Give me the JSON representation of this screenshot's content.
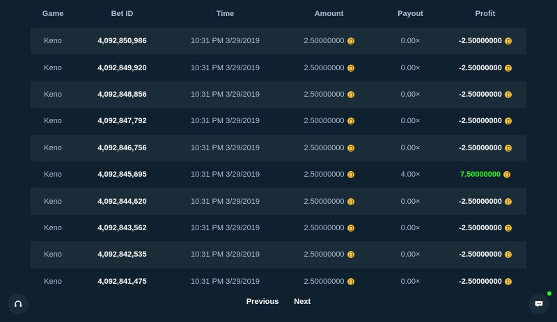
{
  "table": {
    "headers": {
      "game": "Game",
      "bet_id": "Bet ID",
      "time": "Time",
      "amount": "Amount",
      "payout": "Payout",
      "profit": "Profit"
    },
    "rows": [
      {
        "game": "Keno",
        "bet_id": "4,092,850,986",
        "time": "10:31 PM 3/29/2019",
        "amount": "2.50000000",
        "payout": "0.00×",
        "profit": "-2.50000000",
        "win": false
      },
      {
        "game": "Keno",
        "bet_id": "4,092,849,920",
        "time": "10:31 PM 3/29/2019",
        "amount": "2.50000000",
        "payout": "0.00×",
        "profit": "-2.50000000",
        "win": false
      },
      {
        "game": "Keno",
        "bet_id": "4,092,848,856",
        "time": "10:31 PM 3/29/2019",
        "amount": "2.50000000",
        "payout": "0.00×",
        "profit": "-2.50000000",
        "win": false
      },
      {
        "game": "Keno",
        "bet_id": "4,092,847,792",
        "time": "10:31 PM 3/29/2019",
        "amount": "2.50000000",
        "payout": "0.00×",
        "profit": "-2.50000000",
        "win": false
      },
      {
        "game": "Keno",
        "bet_id": "4,092,846,756",
        "time": "10:31 PM 3/29/2019",
        "amount": "2.50000000",
        "payout": "0.00×",
        "profit": "-2.50000000",
        "win": false
      },
      {
        "game": "Keno",
        "bet_id": "4,092,845,695",
        "time": "10:31 PM 3/29/2019",
        "amount": "2.50000000",
        "payout": "4.00×",
        "profit": "7.50000000",
        "win": true
      },
      {
        "game": "Keno",
        "bet_id": "4,092,844,620",
        "time": "10:31 PM 3/29/2019",
        "amount": "2.50000000",
        "payout": "0.00×",
        "profit": "-2.50000000",
        "win": false
      },
      {
        "game": "Keno",
        "bet_id": "4,092,843,562",
        "time": "10:31 PM 3/29/2019",
        "amount": "2.50000000",
        "payout": "0.00×",
        "profit": "-2.50000000",
        "win": false
      },
      {
        "game": "Keno",
        "bet_id": "4,092,842,535",
        "time": "10:31 PM 3/29/2019",
        "amount": "2.50000000",
        "payout": "0.00×",
        "profit": "-2.50000000",
        "win": false
      },
      {
        "game": "Keno",
        "bet_id": "4,092,841,475",
        "time": "10:31 PM 3/29/2019",
        "amount": "2.50000000",
        "payout": "0.00×",
        "profit": "-2.50000000",
        "win": false
      }
    ]
  },
  "pagination": {
    "previous_label": "Previous",
    "next_label": "Next"
  },
  "icons": {
    "currency": "coin-icon",
    "support": "headset-icon",
    "chat": "chat-bubble-icon"
  },
  "colors": {
    "background": "#0f212e",
    "row_alt": "#1a2c38",
    "win": "#1fff20",
    "coin": "#f5c33b"
  }
}
